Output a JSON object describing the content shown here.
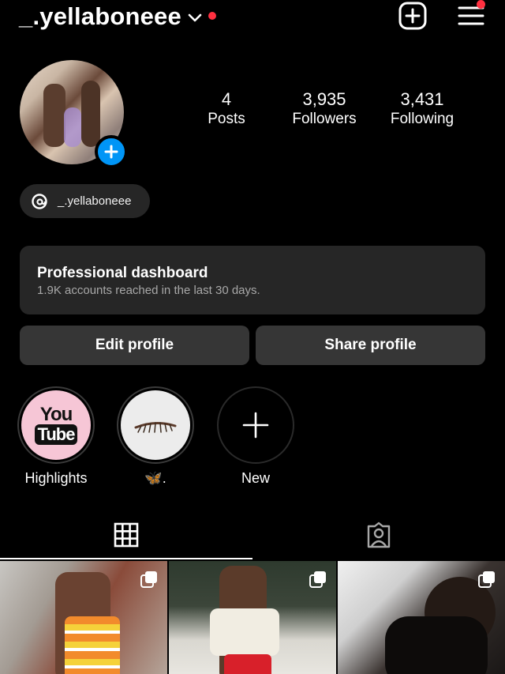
{
  "header": {
    "username": "_.yellaboneee",
    "icons": [
      "chevron-down-icon",
      "create-post-icon",
      "menu-icon"
    ],
    "notification_color": "#ff3040"
  },
  "profile": {
    "stats": [
      {
        "value": "4",
        "label": "Posts"
      },
      {
        "value": "3,935",
        "label": "Followers"
      },
      {
        "value": "3,431",
        "label": "Following"
      }
    ],
    "threads_handle": "_.yellaboneee",
    "accent": "#0095f6"
  },
  "dashboard": {
    "title": "Professional dashboard",
    "subtitle": "1.9K accounts reached in the last 30 days."
  },
  "actions": {
    "edit_label": "Edit profile",
    "share_label": "Share profile"
  },
  "highlights": [
    {
      "label": "Highlights",
      "cover_text_top": "You",
      "cover_text_bottom": "Tube"
    },
    {
      "label": "🦋."
    },
    {
      "label": "New"
    }
  ],
  "tabs": [
    {
      "name": "posts-grid",
      "icon": "grid-icon",
      "active": true
    },
    {
      "name": "tagged",
      "icon": "tagged-person-icon",
      "active": false
    }
  ],
  "posts": [
    {
      "type": "carousel"
    },
    {
      "type": "carousel"
    },
    {
      "type": "carousel"
    }
  ]
}
